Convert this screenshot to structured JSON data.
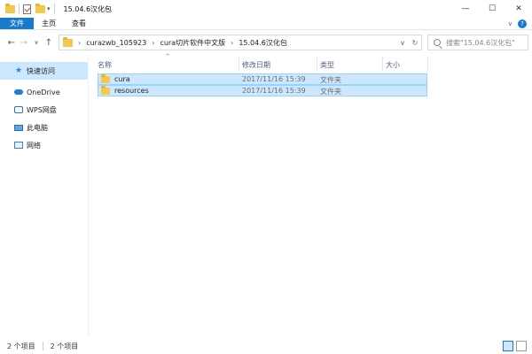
{
  "window": {
    "title": "15.04.6汉化包",
    "minimize_glyph": "—",
    "maximize_glyph": "☐",
    "close_glyph": "✕"
  },
  "ribbon": {
    "tabs": [
      {
        "label": "文件"
      },
      {
        "label": "主页"
      },
      {
        "label": "查看"
      }
    ],
    "expand_glyph": "∨",
    "help_glyph": "?"
  },
  "nav": {
    "back_glyph": "←",
    "forward_glyph": "→",
    "recent_glyph": "∨",
    "up_glyph": "↑",
    "breadcrumbs": [
      "curazwb_105923",
      "cura切片软件中文版",
      "15.04.6汉化包"
    ],
    "crumb_sep": "›",
    "dropdown_glyph": "∨",
    "refresh_glyph": "↻",
    "search_placeholder": "搜索\"15.04.6汉化包\""
  },
  "sidebar": {
    "items": [
      {
        "label": "快速访问",
        "icon": "star-icon"
      },
      {
        "label": "OneDrive",
        "icon": "cloud-icon"
      },
      {
        "label": "WPS网盘",
        "icon": "cloud-drive-icon"
      },
      {
        "label": "此电脑",
        "icon": "computer-icon"
      },
      {
        "label": "网络",
        "icon": "network-icon"
      }
    ]
  },
  "columns": {
    "name": "名称",
    "modified": "修改日期",
    "type": "类型",
    "size": "大小"
  },
  "files": [
    {
      "name": "cura",
      "modified": "2017/11/16 15:39",
      "type": "文件夹",
      "size": ""
    },
    {
      "name": "resources",
      "modified": "2017/11/16 15:39",
      "type": "文件夹",
      "size": ""
    }
  ],
  "status": {
    "item_count": "2 个项目",
    "selected_count": "2 个项目"
  },
  "colors": {
    "accent": "#1979ca",
    "selection": "#cce8ff",
    "folder": "#f2c94c"
  }
}
